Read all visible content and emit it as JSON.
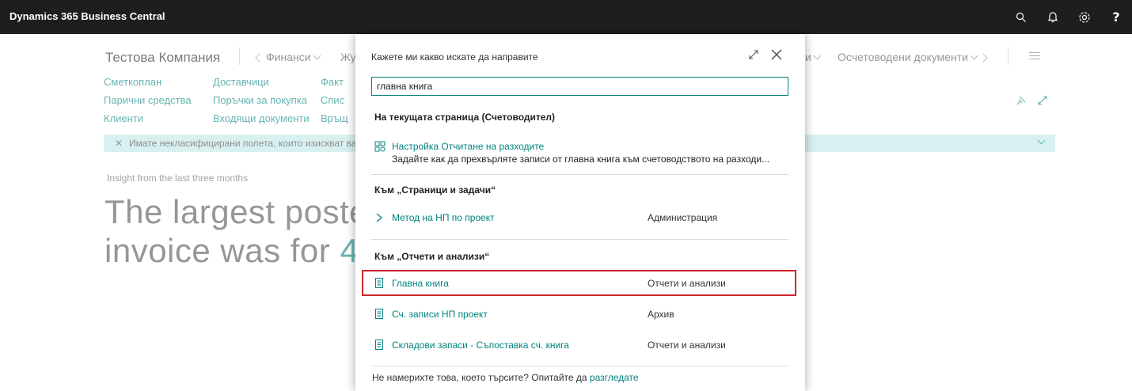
{
  "app": {
    "title": "Dynamics 365 Business Central"
  },
  "topbar": {
    "icons": [
      "search-icon",
      "bell-icon",
      "gear-icon",
      "help-icon"
    ],
    "help_label": "?"
  },
  "nav": {
    "company": "Тестова Компания",
    "items": [
      {
        "label": "Финанси"
      },
      {
        "label": "Жу"
      },
      {
        "label": "и"
      },
      {
        "label": "Осчетоводени документи"
      }
    ]
  },
  "links": {
    "col1": [
      "Сметкоплан",
      "Парични средства",
      "Клиенти"
    ],
    "col2": [
      "Доставчици",
      "Поръчки за покупка",
      "Входящи документи"
    ],
    "col3": [
      "Факт",
      "Спис",
      "Връщ"
    ]
  },
  "notification": {
    "text": "Имате некласифицирани полета, които изискват ва"
  },
  "insight": {
    "caption": "Insight from the last three months",
    "line1": "The largest postec",
    "line2_prefix": "invoice was for ",
    "line2_accent": "48"
  },
  "dialog": {
    "title": "Кажете ми какво искате да направите",
    "search_value": "главна книга",
    "section1": "На текущата страница (Счетоводител)",
    "result1": {
      "label": "Настройка Отчитане на разходите",
      "description": "Задайте как да прехвърляте записи от главна книга към счетоводството на разходи..."
    },
    "section2": "Към „Страници и задачи“",
    "result2": {
      "label": "Метод на НП по проект",
      "category": "Администрация"
    },
    "section3": "Към „Отчети и анализи“",
    "results3": [
      {
        "label": "Главна книга",
        "category": "Отчети и анализи"
      },
      {
        "label": "Сч. записи НП проект",
        "category": "Архив"
      },
      {
        "label": "Складови запаси - Съпоставка сч. книга",
        "category": "Отчети и анализи"
      }
    ],
    "footer_text": "Не намерихте това, което търсите? Опитайте да ",
    "footer_link": "разгледате"
  },
  "colors": {
    "accent": "#00827f",
    "topbar": "#1e1e1e",
    "highlight": "#d0252d",
    "notification": "#bfe7e6"
  }
}
